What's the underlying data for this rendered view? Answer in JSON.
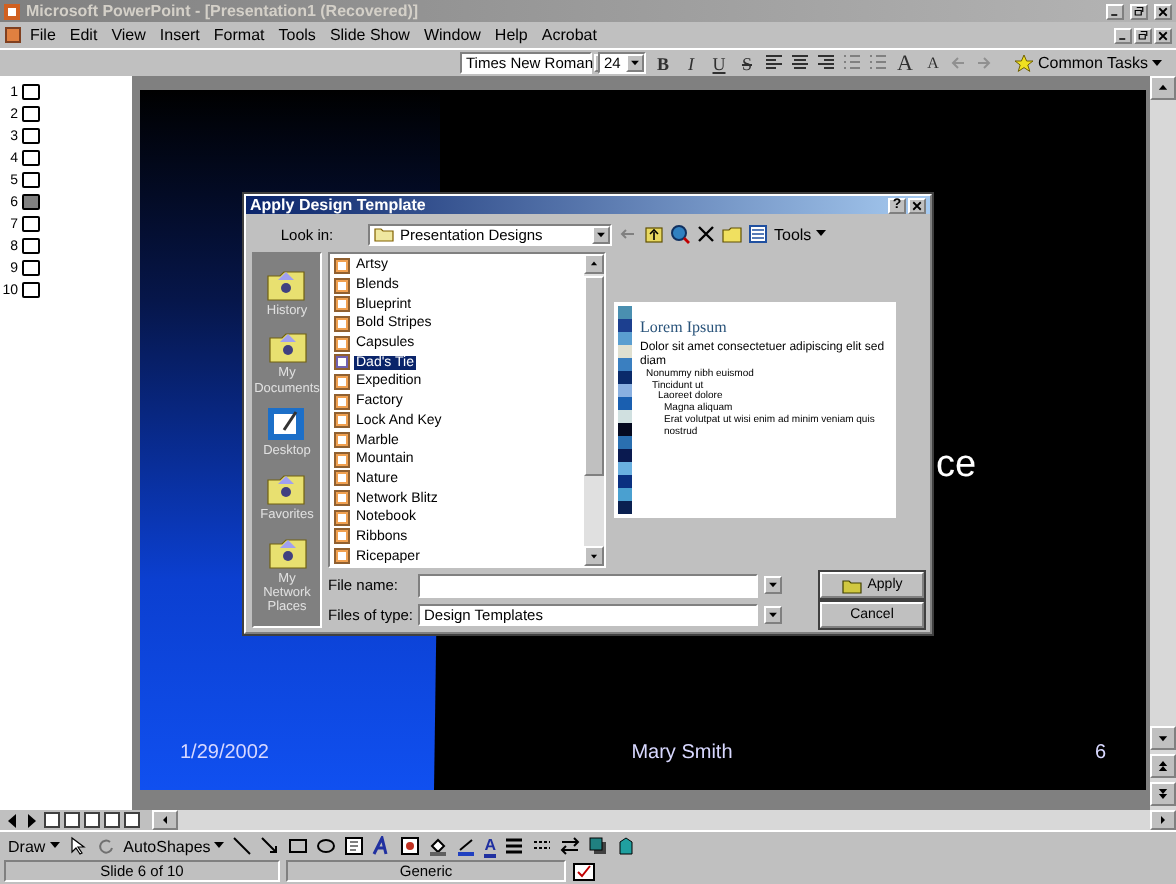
{
  "window": {
    "title": "Microsoft PowerPoint - [Presentation1 (Recovered)]"
  },
  "menu": [
    "File",
    "Edit",
    "View",
    "Insert",
    "Format",
    "Tools",
    "Slide Show",
    "Window",
    "Help",
    "Acrobat"
  ],
  "formatting_toolbar": {
    "font": "Times New Roman",
    "size": "24",
    "style_buttons": [
      "B",
      "I",
      "U",
      "S"
    ],
    "size_buttons": [
      "A",
      "A"
    ],
    "common_tasks": "Common Tasks"
  },
  "outline": {
    "slides": [
      {
        "number": "1",
        "selected": false
      },
      {
        "number": "2",
        "selected": false
      },
      {
        "number": "3",
        "selected": false
      },
      {
        "number": "4",
        "selected": false
      },
      {
        "number": "5",
        "selected": false
      },
      {
        "number": "6",
        "selected": true
      },
      {
        "number": "7",
        "selected": false
      },
      {
        "number": "8",
        "selected": false
      },
      {
        "number": "9",
        "selected": false
      },
      {
        "number": "10",
        "selected": false
      }
    ]
  },
  "slide": {
    "title_fragment": "ce",
    "date": "1/29/2002",
    "author": "Mary Smith",
    "number": "6"
  },
  "dialog": {
    "title": "Apply Design Template",
    "help": "?",
    "look_in_label": "Look in:",
    "look_in": "Presentation Designs",
    "tools": "Tools",
    "places": [
      {
        "label": "History",
        "kind": "folder"
      },
      {
        "label": "My Documents",
        "kind": "folder"
      },
      {
        "label": "Desktop",
        "kind": "desktop"
      },
      {
        "label": "Favorites",
        "kind": "folder"
      },
      {
        "label": "My Network Places",
        "kind": "folder"
      }
    ],
    "files": [
      {
        "name": "Artsy",
        "selected": false
      },
      {
        "name": "Blends",
        "selected": false
      },
      {
        "name": "Blueprint",
        "selected": false
      },
      {
        "name": "Bold Stripes",
        "selected": false
      },
      {
        "name": "Capsules",
        "selected": false
      },
      {
        "name": "Dad's Tie",
        "selected": true
      },
      {
        "name": "Expedition",
        "selected": false
      },
      {
        "name": "Factory",
        "selected": false
      },
      {
        "name": "Lock And Key",
        "selected": false
      },
      {
        "name": "Marble",
        "selected": false
      },
      {
        "name": "Mountain",
        "selected": false
      },
      {
        "name": "Nature",
        "selected": false
      },
      {
        "name": "Network Blitz",
        "selected": false
      },
      {
        "name": "Notebook",
        "selected": false
      },
      {
        "name": "Ribbons",
        "selected": false
      },
      {
        "name": "Ricepaper",
        "selected": false
      }
    ],
    "preview": {
      "title": "Lorem Ipsum",
      "bullets": [
        {
          "text": "Dolor sit amet consectetuer adipiscing elit sed diam",
          "children": [
            {
              "text": "Nonummy nibh euismod",
              "children": [
                {
                  "text": "Tincidunt ut",
                  "children": [
                    {
                      "text": "Laoreet dolore",
                      "children": [
                        {
                          "text": "Magna aliquam"
                        },
                        {
                          "text": "Erat volutpat ut wisi enim ad minim veniam quis nostrud"
                        }
                      ]
                    }
                  ]
                }
              ]
            }
          ]
        }
      ]
    },
    "file_name_label": "File name:",
    "file_type_label": "Files of type:",
    "file_type": "Design Templates",
    "buttons": [
      "Apply",
      "Cancel"
    ]
  },
  "drawing_toolbar": {
    "draw": "Draw",
    "autoshapes": "AutoShapes",
    "font_color": "A"
  },
  "status_bar": [
    "Slide 6 of 10",
    "Generic"
  ]
}
